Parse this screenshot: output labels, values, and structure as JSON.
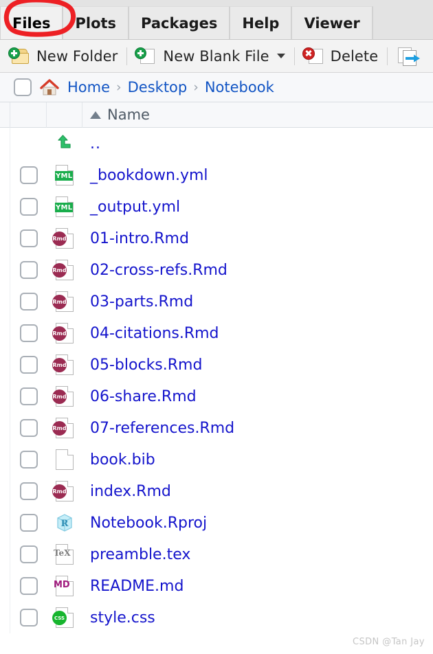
{
  "tabs": {
    "items": [
      {
        "label": "Files",
        "active": true,
        "annotated": true
      },
      {
        "label": "Plots",
        "active": false,
        "annotated": false
      },
      {
        "label": "Packages",
        "active": false,
        "annotated": false
      },
      {
        "label": "Help",
        "active": false,
        "annotated": false
      },
      {
        "label": "Viewer",
        "active": false,
        "annotated": false
      }
    ]
  },
  "toolbar": {
    "new_folder_label": "New Folder",
    "new_blank_file_label": "New Blank File",
    "delete_label": "Delete",
    "new_folder_icon": "new-folder-icon",
    "new_blank_file_icon": "new-file-icon",
    "new_blank_file_caret": "chevron-down-icon",
    "delete_icon": "delete-icon",
    "rename_icon": "rename-move-icon"
  },
  "pathbar": {
    "select_all_checkbox": "",
    "home_icon": "home-icon",
    "crumbs": [
      "Home",
      "Desktop",
      "Notebook"
    ],
    "separator": "›"
  },
  "column_header": {
    "sort_indicator": "sort-ascending-icon",
    "name_label": "Name"
  },
  "files": [
    {
      "name": "..",
      "icon": "up-directory-icon",
      "kind": "updir",
      "badge": "",
      "checkbox": true
    },
    {
      "name": "_bookdown.yml",
      "icon": "yml-file-icon",
      "kind": "rect",
      "badge": "YML",
      "checkbox": true
    },
    {
      "name": "_output.yml",
      "icon": "yml-file-icon",
      "kind": "rect",
      "badge": "YML",
      "checkbox": true
    },
    {
      "name": "01-intro.Rmd",
      "icon": "rmd-file-icon",
      "kind": "rmd",
      "badge": "Rmd",
      "checkbox": true
    },
    {
      "name": "02-cross-refs.Rmd",
      "icon": "rmd-file-icon",
      "kind": "rmd",
      "badge": "Rmd",
      "checkbox": true
    },
    {
      "name": "03-parts.Rmd",
      "icon": "rmd-file-icon",
      "kind": "rmd",
      "badge": "Rmd",
      "checkbox": true
    },
    {
      "name": "04-citations.Rmd",
      "icon": "rmd-file-icon",
      "kind": "rmd",
      "badge": "Rmd",
      "checkbox": true
    },
    {
      "name": "05-blocks.Rmd",
      "icon": "rmd-file-icon",
      "kind": "rmd",
      "badge": "Rmd",
      "checkbox": true
    },
    {
      "name": "06-share.Rmd",
      "icon": "rmd-file-icon",
      "kind": "rmd",
      "badge": "Rmd",
      "checkbox": true
    },
    {
      "name": "07-references.Rmd",
      "icon": "rmd-file-icon",
      "kind": "rmd",
      "badge": "Rmd",
      "checkbox": true
    },
    {
      "name": "book.bib",
      "icon": "plain-file-icon",
      "kind": "plain",
      "badge": "",
      "checkbox": true
    },
    {
      "name": "index.Rmd",
      "icon": "rmd-file-icon",
      "kind": "rmd",
      "badge": "Rmd",
      "checkbox": true
    },
    {
      "name": "Notebook.Rproj",
      "icon": "rproj-file-icon",
      "kind": "cube",
      "badge": "R",
      "checkbox": true
    },
    {
      "name": "preamble.tex",
      "icon": "tex-file-icon",
      "kind": "tex",
      "badge": "TeX",
      "checkbox": true
    },
    {
      "name": "README.md",
      "icon": "md-file-icon",
      "kind": "md",
      "badge": "MD",
      "checkbox": true
    },
    {
      "name": "style.css",
      "icon": "css-file-icon",
      "kind": "css",
      "badge": "CSS",
      "checkbox": true
    }
  ],
  "watermark": "CSDN @Tan Jay",
  "colors": {
    "link": "#1414cc",
    "crumb": "#1154c4",
    "annotation": "#ed2024",
    "yml_badge": "#19ad4b",
    "rmd_badge": "#9b2b52",
    "css_badge": "#17b52e",
    "md_badge": "#a01a7d",
    "tex_badge": "#7e7e7e"
  }
}
